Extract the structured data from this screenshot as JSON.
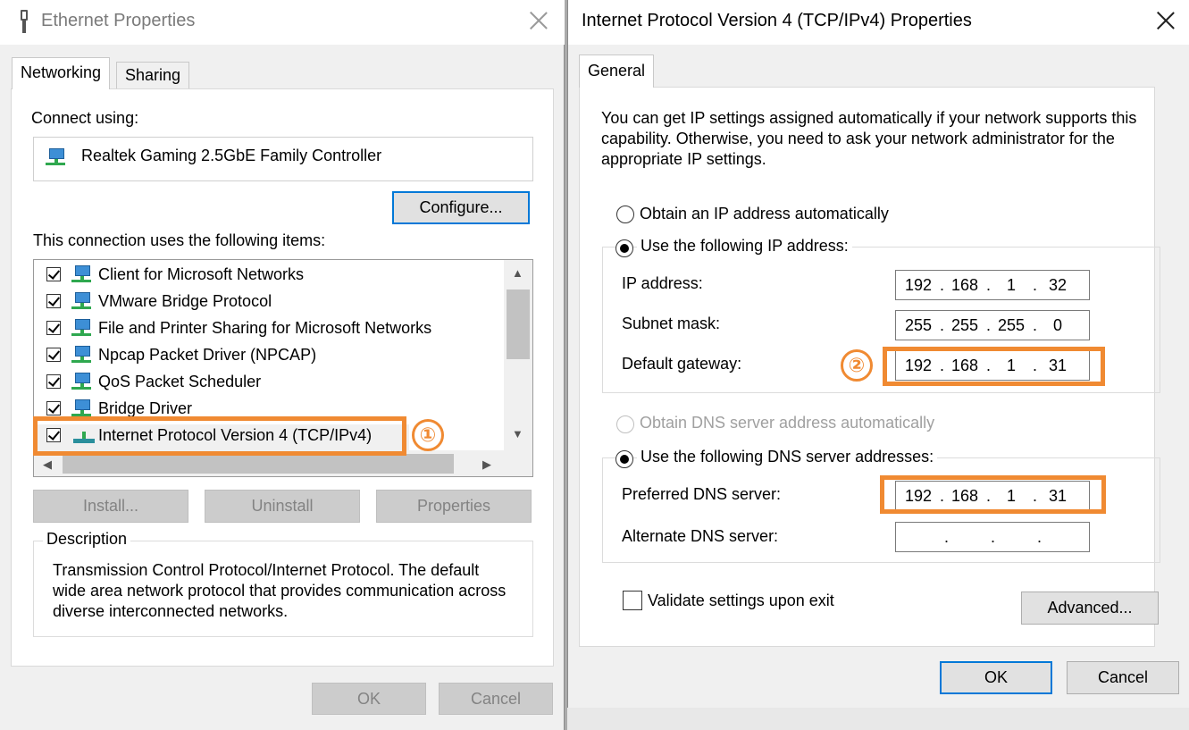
{
  "ethernet_dialog": {
    "title": "Ethernet Properties",
    "tabs": [
      {
        "label": "Networking",
        "active": true
      },
      {
        "label": "Sharing",
        "active": false
      }
    ],
    "connect_using_label": "Connect using:",
    "adapter_name": "Realtek Gaming 2.5GbE Family Controller",
    "configure_label": "Configure...",
    "items_label": "This connection uses the following items:",
    "items": [
      {
        "label": "Client for Microsoft Networks",
        "checked": true,
        "icon": "network-client-icon"
      },
      {
        "label": "VMware Bridge Protocol",
        "checked": true,
        "icon": "network-protocol-icon"
      },
      {
        "label": "File and Printer Sharing for Microsoft Networks",
        "checked": true,
        "icon": "network-service-icon"
      },
      {
        "label": "Npcap Packet Driver (NPCAP)",
        "checked": true,
        "icon": "network-protocol-icon"
      },
      {
        "label": "QoS Packet Scheduler",
        "checked": true,
        "icon": "network-service-icon"
      },
      {
        "label": "Bridge Driver",
        "checked": true,
        "icon": "network-protocol-icon"
      },
      {
        "label": "Internet Protocol Version 4 (TCP/IPv4)",
        "checked": true,
        "icon": "network-protocol-icon"
      }
    ],
    "install_label": "Install...",
    "uninstall_label": "Uninstall",
    "properties_label": "Properties",
    "description_legend": "Description",
    "description_text": "Transmission Control Protocol/Internet Protocol. The default wide area network protocol that provides communication across diverse interconnected networks.",
    "ok_label": "OK",
    "cancel_label": "Cancel"
  },
  "ipv4_dialog": {
    "title": "Internet Protocol Version 4 (TCP/IPv4) Properties",
    "tab_label": "General",
    "intro_text": "You can get IP settings assigned automatically if your network supports this capability. Otherwise, you need to ask your network administrator for the appropriate IP settings.",
    "obtain_ip_auto_label": "Obtain an IP address automatically",
    "use_following_ip_label": "Use the following IP address:",
    "ip_address_label": "IP address:",
    "ip_address": [
      "192",
      "168",
      "1",
      "32"
    ],
    "subnet_mask_label": "Subnet mask:",
    "subnet_mask": [
      "255",
      "255",
      "255",
      "0"
    ],
    "default_gateway_label": "Default gateway:",
    "default_gateway": [
      "192",
      "168",
      "1",
      "31"
    ],
    "obtain_dns_auto_label": "Obtain DNS server address automatically",
    "use_following_dns_label": "Use the following DNS server addresses:",
    "preferred_dns_label": "Preferred DNS server:",
    "preferred_dns": [
      "192",
      "168",
      "1",
      "31"
    ],
    "alternate_dns_label": "Alternate DNS server:",
    "alternate_dns": [
      "",
      "",
      "",
      ""
    ],
    "validate_label": "Validate settings upon exit",
    "validate_checked": false,
    "advanced_label": "Advanced...",
    "ok_label": "OK",
    "cancel_label": "Cancel"
  },
  "annotations": {
    "step1": "①",
    "step2": "②",
    "color": "#f08a32"
  }
}
